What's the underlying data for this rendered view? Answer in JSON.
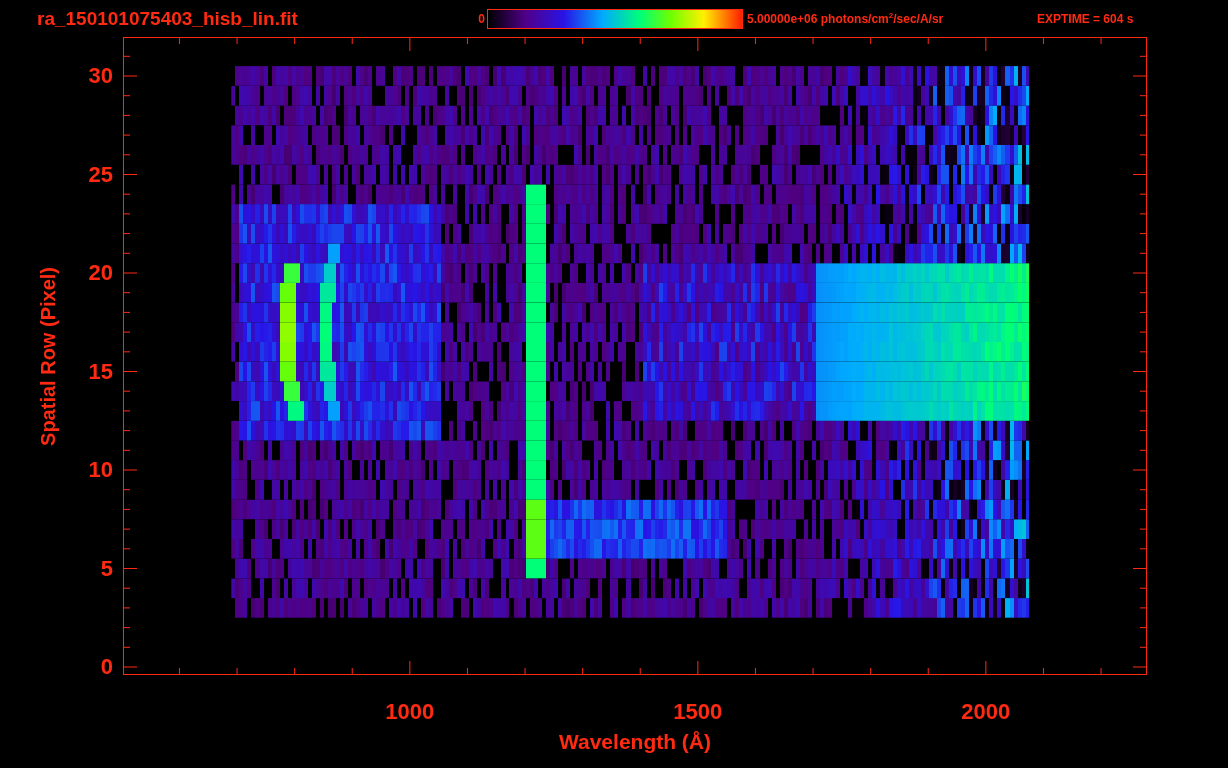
{
  "title": "ra_150101075403_hisb_lin.fit",
  "colorbar": {
    "min_label": "0",
    "max_label": "5.00000e+06 photons/cm$^{2}$/sec/A/sr"
  },
  "exposure": "EXPTIME = 604 s",
  "plot": {
    "xlabel": "Wavelength (Å)",
    "ylabel": "Spatial Row (Pixel)",
    "xticks": [
      "1000",
      "1500",
      "2000"
    ],
    "yticks": [
      "30",
      "25",
      "20",
      "15",
      "10",
      "5",
      "0"
    ]
  }
}
